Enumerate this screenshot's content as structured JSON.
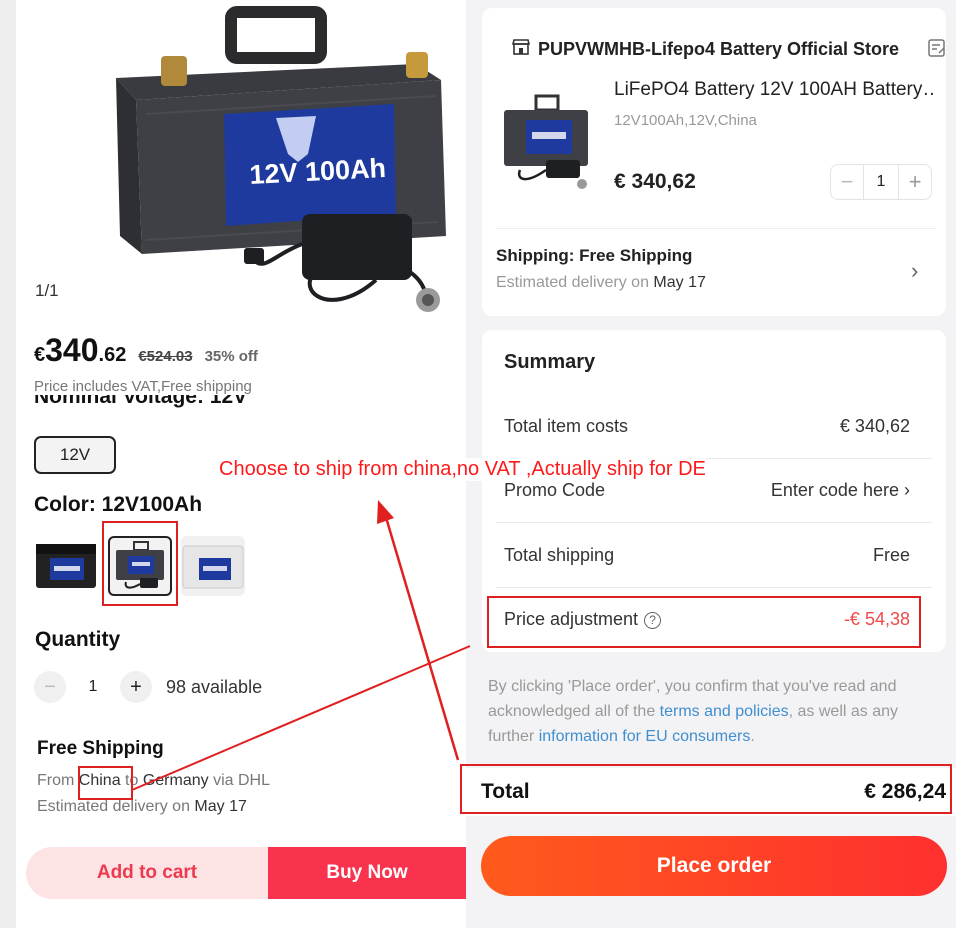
{
  "product": {
    "image_counter": "1/1",
    "battery_label": "12V 100Ah",
    "price_currency": "€",
    "price_integer": "340",
    "price_decimal": ".62",
    "original_price": "€524.03",
    "discount": "35% off",
    "price_note": "Price includes VAT,Free shipping",
    "nominal_voltage_label": "Nominal Voltage: 12V",
    "voltage_option": "12V",
    "color_label": "Color: 12V100Ah",
    "color_swatches": [
      {
        "name": "black-top",
        "selected": false
      },
      {
        "name": "grey-with-charger",
        "selected": true
      },
      {
        "name": "white",
        "selected": false
      }
    ],
    "quantity_label": "Quantity",
    "quantity_value": "1",
    "available": "98 available",
    "shipping_title": "Free Shipping",
    "shipping_from_prefix": "From ",
    "shipping_from_country": "China",
    "shipping_to": " to ",
    "shipping_dest": "Germany",
    "shipping_via": " via DHL",
    "delivery_prefix": "Estimated delivery on ",
    "delivery_date": "May 17",
    "add_to_cart": "Add to cart",
    "buy_now": "Buy Now"
  },
  "order": {
    "store_name": "PUPVWMHB-Lifepo4 Battery Official Store",
    "item_title": "LiFePO4 Battery 12V 100AH Battery…",
    "item_variant": "12V100Ah,12V,China",
    "item_price": "€ 340,62",
    "item_qty": "1",
    "shipping_label_prefix": "Shipping: ",
    "shipping_label_value": "Free Shipping",
    "delivery_prefix": "Estimated delivery on ",
    "delivery_date": "May 17",
    "summary_title": "Summary",
    "rows": {
      "item_costs_label": "Total item costs",
      "item_costs_value": "€ 340,62",
      "promo_label": "Promo Code",
      "promo_value": "Enter code here",
      "shipping_label": "Total shipping",
      "shipping_value": "Free",
      "adjust_label": "Price adjustment",
      "adjust_value": "-€ 54,38"
    },
    "legal_1": "By clicking 'Place order', you confirm that you've read and acknowledged all of the ",
    "legal_link_1": "terms and policies",
    "legal_2": ", as well as any further ",
    "legal_link_2": "information for EU consumers",
    "legal_3": ".",
    "total_label": "Total",
    "total_value": "€ 286,24",
    "place_order": "Place order"
  },
  "annotation": {
    "text": "Choose to ship from china,no VAT ,Actually ship for DE",
    "color": "#ff1a1a"
  },
  "colors": {
    "accent_red": "#f9324e",
    "cart_bg": "#fde3e4",
    "place_order_start": "#ff5a1c",
    "place_order_end": "#ff2f2f",
    "price_adjust_red": "#f04a4a",
    "link_blue": "#3f8ecf"
  }
}
